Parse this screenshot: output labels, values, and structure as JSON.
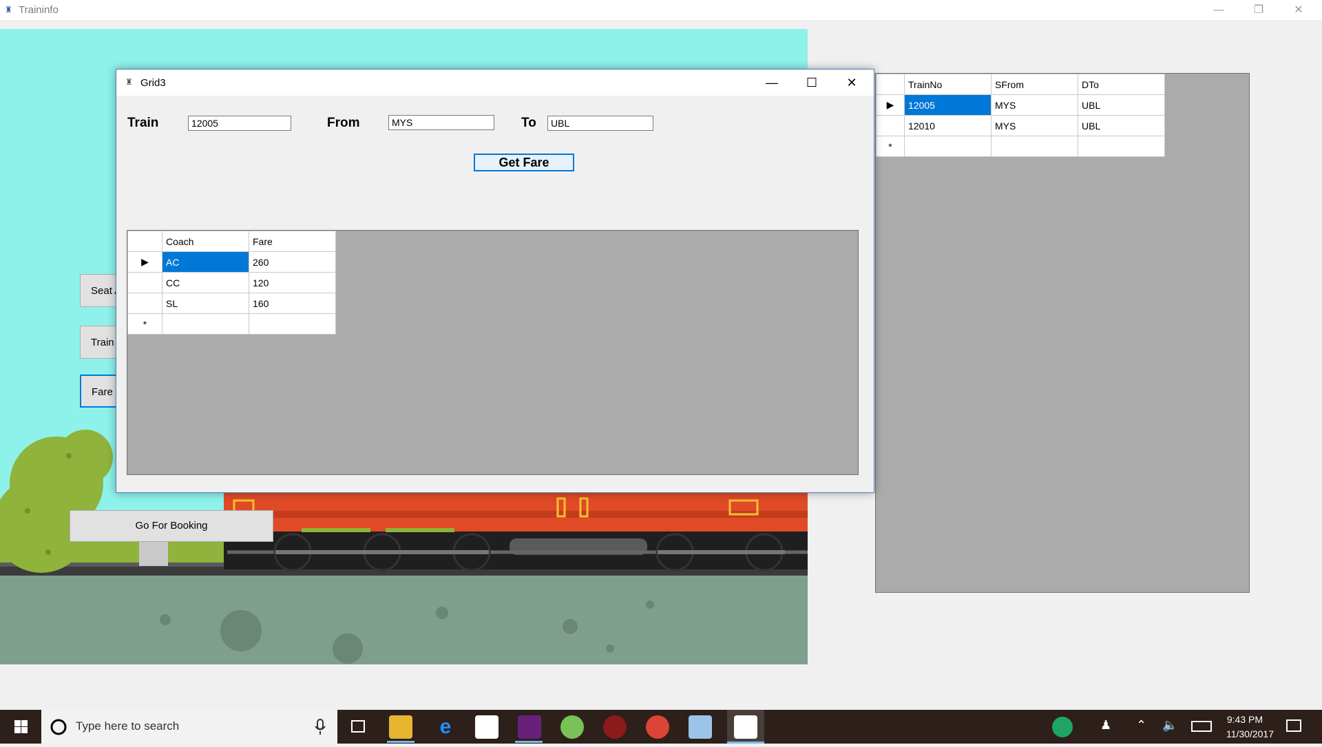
{
  "main_window": {
    "title": "Traininfo",
    "buttons": [
      "minimize",
      "restore",
      "close"
    ]
  },
  "side_buttons": [
    "Seat A",
    "Train T",
    "Fare"
  ],
  "booking_button": "Go For Booking",
  "right_grid": {
    "columns": [
      "TrainNo",
      "SFrom",
      "DTo"
    ],
    "rows": [
      [
        "12005",
        "MYS",
        "UBL"
      ],
      [
        "12010",
        "MYS",
        "UBL"
      ]
    ]
  },
  "dialog": {
    "title": "Grid3",
    "train_label": "Train",
    "train_value": "12005",
    "from_label": "From",
    "from_value": "MYS",
    "to_label": "To",
    "to_value": "UBL",
    "get_fare_label": "Get Fare",
    "fare_grid": {
      "columns": [
        "Coach",
        "Fare"
      ],
      "rows": [
        [
          "AC",
          "260"
        ],
        [
          "CC",
          "120"
        ],
        [
          "SL",
          "160"
        ]
      ]
    }
  },
  "taskbar": {
    "search_placeholder": "Type here to search",
    "time": "9:43 PM",
    "date": "11/30/2017",
    "icons": [
      "task-view-icon",
      "file-explorer-icon",
      "edge-icon",
      "store-icon",
      "visual-studio-icon",
      "android-studio-icon",
      "app-icon",
      "chrome-icon",
      "photos-icon",
      "traininfo-app-icon"
    ]
  },
  "colors": {
    "scene_sky": "#8ef2ea",
    "selection": "#0078d7",
    "grid_bg": "#ababab"
  }
}
